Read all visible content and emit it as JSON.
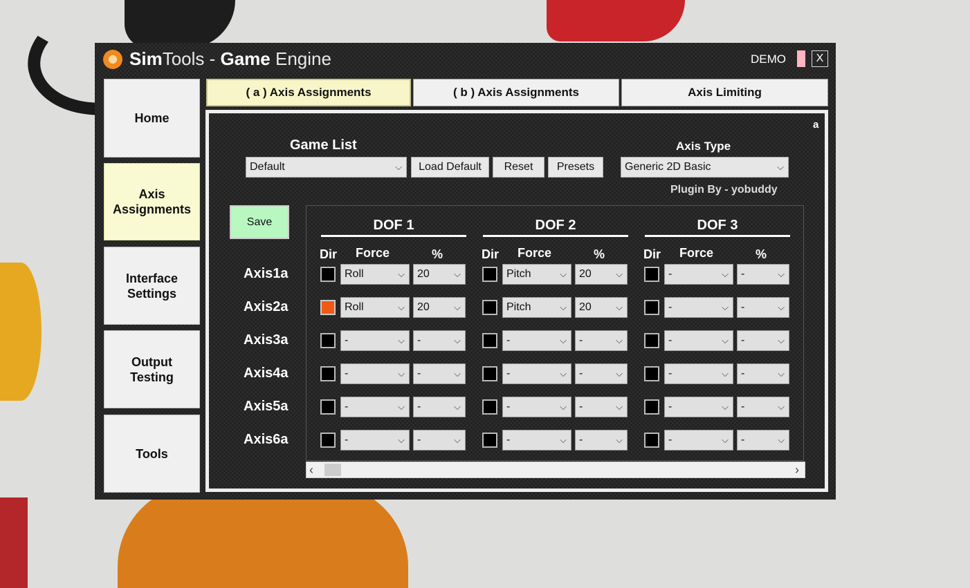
{
  "window": {
    "title_parts": [
      "Sim",
      "Tools",
      " - ",
      "Game",
      " Engine"
    ],
    "demo_label": "DEMO",
    "close_label": "X"
  },
  "nav": [
    {
      "label": "Home",
      "active": false
    },
    {
      "label": "Axis Assignments",
      "active": true
    },
    {
      "label": "Interface Settings",
      "active": false
    },
    {
      "label": "Output Testing",
      "active": false
    },
    {
      "label": "Tools",
      "active": false
    }
  ],
  "tabs": [
    {
      "label": "( a ) Axis Assignments",
      "active": true
    },
    {
      "label": "( b ) Axis Assignments",
      "active": false
    },
    {
      "label": "Axis Limiting",
      "active": false
    }
  ],
  "panel": {
    "corner_letter": "a",
    "game_list_label": "Game List",
    "game_list_value": "Default",
    "load_default_label": "Load Default",
    "reset_label": "Reset",
    "presets_label": "Presets",
    "axis_type_label": "Axis Type",
    "axis_type_value": "Generic 2D Basic",
    "plugin_by": "Plugin By - yobuddy",
    "save_label": "Save"
  },
  "dofs": [
    "DOF 1",
    "DOF 2",
    "DOF 3"
  ],
  "col_headers": {
    "dir": "Dir",
    "force": "Force",
    "percent": "%"
  },
  "axes": [
    {
      "label": "Axis1a",
      "cells": [
        {
          "dir_on": false,
          "force": "Roll",
          "pct": "20"
        },
        {
          "dir_on": false,
          "force": "Pitch",
          "pct": "20"
        },
        {
          "dir_on": false,
          "force": "-",
          "pct": "-"
        }
      ]
    },
    {
      "label": "Axis2a",
      "cells": [
        {
          "dir_on": true,
          "force": "Roll",
          "pct": "20"
        },
        {
          "dir_on": false,
          "force": "Pitch",
          "pct": "20"
        },
        {
          "dir_on": false,
          "force": "-",
          "pct": "-"
        }
      ]
    },
    {
      "label": "Axis3a",
      "cells": [
        {
          "dir_on": false,
          "force": "-",
          "pct": "-"
        },
        {
          "dir_on": false,
          "force": "-",
          "pct": "-"
        },
        {
          "dir_on": false,
          "force": "-",
          "pct": "-"
        }
      ]
    },
    {
      "label": "Axis4a",
      "cells": [
        {
          "dir_on": false,
          "force": "-",
          "pct": "-"
        },
        {
          "dir_on": false,
          "force": "-",
          "pct": "-"
        },
        {
          "dir_on": false,
          "force": "-",
          "pct": "-"
        }
      ]
    },
    {
      "label": "Axis5a",
      "cells": [
        {
          "dir_on": false,
          "force": "-",
          "pct": "-"
        },
        {
          "dir_on": false,
          "force": "-",
          "pct": "-"
        },
        {
          "dir_on": false,
          "force": "-",
          "pct": "-"
        }
      ]
    },
    {
      "label": "Axis6a",
      "cells": [
        {
          "dir_on": false,
          "force": "-",
          "pct": "-"
        },
        {
          "dir_on": false,
          "force": "-",
          "pct": "-"
        },
        {
          "dir_on": false,
          "force": "-",
          "pct": "-"
        }
      ]
    }
  ],
  "colors": {
    "dir_active": "#f05a14",
    "save_bg": "#b8f8c0",
    "active_nav_bg": "#fafad2"
  }
}
